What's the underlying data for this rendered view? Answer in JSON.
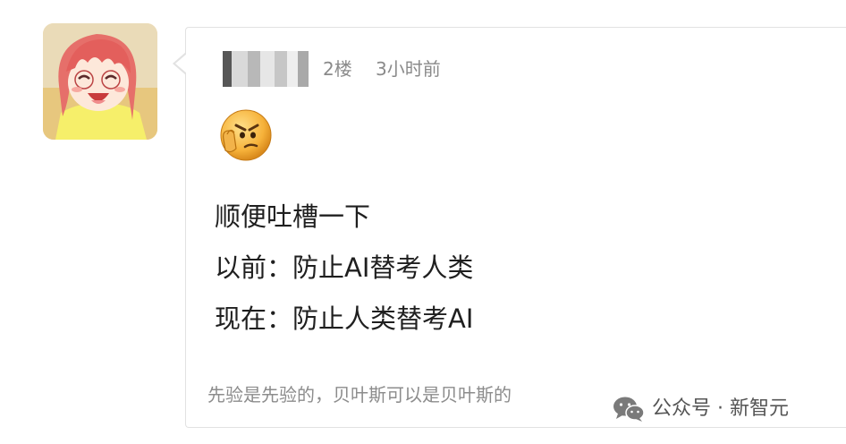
{
  "comment": {
    "floor": "2楼",
    "time": "3小时前",
    "emoji_icon": "smirk-thumb-emoji-icon",
    "lines": [
      "顺便吐槽一下",
      "以前：防止AI替考人类",
      "现在：防止人类替考AI"
    ],
    "signature": "先验是先验的，贝叶斯可以是贝叶斯的"
  },
  "watermark": {
    "icon": "wechat-icon",
    "text": "公众号 · 新智元"
  }
}
